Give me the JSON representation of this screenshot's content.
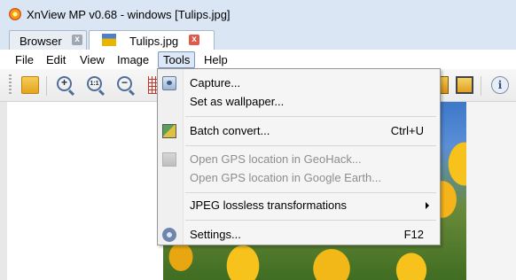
{
  "window": {
    "title": "XnView MP v0.68 - windows [Tulips.jpg]"
  },
  "tabs": [
    {
      "label": "Browser",
      "close": "x"
    },
    {
      "label": "Tulips.jpg",
      "close": "x"
    }
  ],
  "menubar": {
    "file": "File",
    "edit": "Edit",
    "view": "View",
    "image": "Image",
    "tools": "Tools",
    "help": "Help"
  },
  "toolbar": {
    "icons": [
      "folder-icon",
      "zoom-in-icon",
      "zoom-fit-icon",
      "zoom-out-icon",
      "grid-icon",
      "export-icon",
      "crop-icon",
      "info-icon"
    ],
    "zoom_fit_text": "1:1",
    "info_text": "i"
  },
  "tools_menu": {
    "items": [
      {
        "label": "Capture...",
        "shortcut": "",
        "icon": "capture-icon",
        "enabled": true
      },
      {
        "label": "Set as wallpaper...",
        "shortcut": "",
        "icon": "",
        "enabled": true
      },
      {
        "label": "Batch convert...",
        "shortcut": "Ctrl+U",
        "icon": "batch-convert-icon",
        "enabled": true
      },
      {
        "label": "Open GPS location in GeoHack...",
        "shortcut": "",
        "icon": "gps-icon",
        "enabled": false
      },
      {
        "label": "Open GPS location in Google Earth...",
        "shortcut": "",
        "icon": "",
        "enabled": false
      },
      {
        "label": "JPEG lossless transformations",
        "shortcut": "",
        "icon": "",
        "enabled": true,
        "submenu": true
      },
      {
        "label": "Settings...",
        "shortcut": "F12",
        "icon": "settings-icon",
        "enabled": true
      }
    ]
  },
  "colors": {
    "titlebar": "#dbe6f4",
    "menu_highlight": "#dce8f6",
    "disabled_text": "#8d8d8d",
    "tab_close_active": "#e05a4b"
  }
}
